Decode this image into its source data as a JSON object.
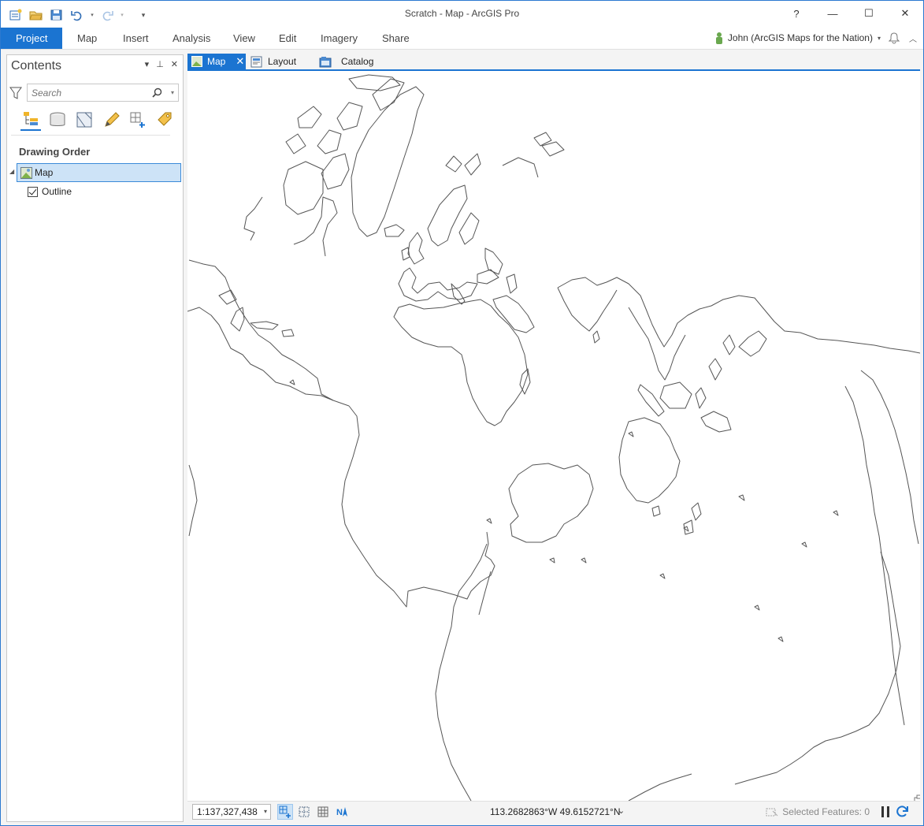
{
  "window": {
    "title": "Scratch - Map - ArcGIS Pro"
  },
  "window_controls": {
    "help": "?",
    "minimize": "—",
    "maximize": "☐",
    "close": "✕"
  },
  "ribbon": {
    "tabs": [
      {
        "label": "Project",
        "active": true
      },
      {
        "label": "Map"
      },
      {
        "label": "Insert"
      },
      {
        "label": "Analysis"
      },
      {
        "label": "View"
      },
      {
        "label": "Edit"
      },
      {
        "label": "Imagery"
      },
      {
        "label": "Share"
      }
    ],
    "user": "John (ArcGIS Maps for the Nation)"
  },
  "contents": {
    "title": "Contents",
    "search_placeholder": "Search",
    "section_title": "Drawing Order",
    "map_item": "Map",
    "layer_item": "Outline",
    "layer_checked": true
  },
  "view_tabs": [
    {
      "label": "Map",
      "active": true
    },
    {
      "label": "Layout"
    },
    {
      "label": "Catalog"
    }
  ],
  "statusbar": {
    "scale": "1:137,327,438",
    "coordinates": "113.2682863°W 49.6152721°N",
    "selected_features": "Selected Features: 0"
  },
  "colors": {
    "accent": "#1b74d1",
    "selection_bg": "#cde3f7",
    "coastline": "#555555"
  }
}
